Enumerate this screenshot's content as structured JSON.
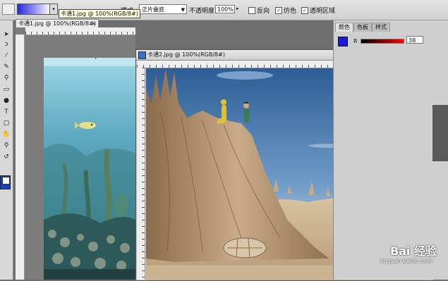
{
  "options_bar": {
    "mode_label": "模式:",
    "mode_value": "正片叠底",
    "opacity_label": "不透明度:",
    "opacity_value": "100%",
    "checkboxes": [
      {
        "label": "反向",
        "checked": false
      },
      {
        "label": "仿色",
        "checked": true
      },
      {
        "label": "透明区域",
        "checked": true
      }
    ],
    "gradient_colors": [
      "#2a2ad8",
      "#ffffff"
    ]
  },
  "tooltip": "卡通1.jpg @ 100%(RGB/8#)",
  "doc1": {
    "tab_title": "卡通1.jpg @ 100%(RGB/8#)",
    "close": "×"
  },
  "doc2": {
    "title": "卡通2.jpg @ 100%(RGB/8#)",
    "min": "—",
    "max": "□",
    "close": "×"
  },
  "panel": {
    "tabs": [
      "颜色",
      "色板",
      "样式"
    ],
    "active_tab": "颜色",
    "channel_label": "R",
    "channel_value": "38",
    "foreground_color": "#1a1ad8"
  },
  "watermark": {
    "logo": "Bai 经验",
    "url": "jingyan.baidu.com"
  }
}
